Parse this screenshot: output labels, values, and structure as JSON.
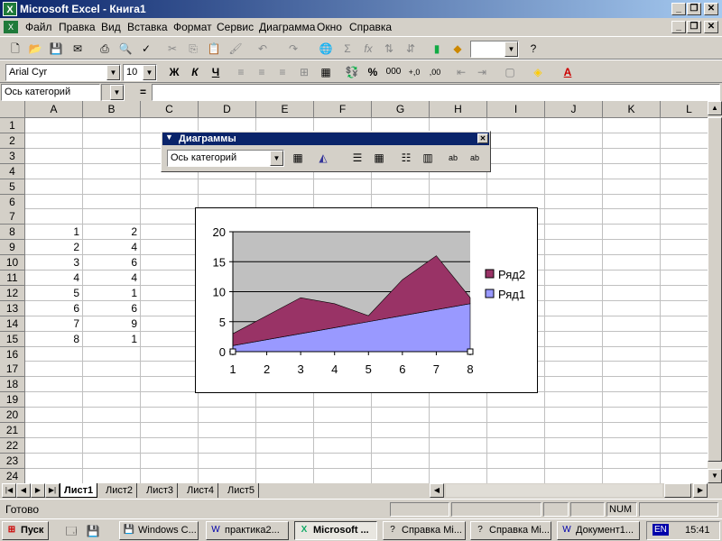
{
  "window": {
    "title": "Microsoft Excel - Книга1",
    "app_icon": "excel-icon"
  },
  "menu": [
    "Файл",
    "Правка",
    "Вид",
    "Вставка",
    "Формат",
    "Сервис",
    "Диаграмма",
    "Окно",
    "Справка"
  ],
  "formatting": {
    "font": "Arial Cyr",
    "size": "10",
    "bold": "Ж",
    "italic": "К",
    "underline": "Ч",
    "percent": "%",
    "thousands": "000",
    "inc_decimal": "+,0",
    "dec_decimal": ",00"
  },
  "formula_bar": {
    "name_box": "Ось категорий",
    "equals": "=",
    "value": ""
  },
  "columns": [
    "A",
    "B",
    "C",
    "D",
    "E",
    "F",
    "G",
    "H",
    "I",
    "J",
    "K",
    "L"
  ],
  "rows": [
    "1",
    "2",
    "3",
    "4",
    "5",
    "6",
    "7",
    "8",
    "9",
    "10",
    "11",
    "12",
    "13",
    "14",
    "15",
    "16",
    "17",
    "18",
    "19",
    "20",
    "21",
    "22",
    "23",
    "24"
  ],
  "cells": {
    "A": [
      "1",
      "2",
      "3",
      "4",
      "5",
      "6",
      "7",
      "8"
    ],
    "B": [
      "2",
      "4",
      "6",
      "4",
      "1",
      "6",
      "9",
      "1"
    ]
  },
  "chart_toolbar": {
    "title": "Диаграммы",
    "selector": "Ось категорий"
  },
  "chart_data": {
    "type": "area",
    "stacked": true,
    "categories": [
      "1",
      "2",
      "3",
      "4",
      "5",
      "6",
      "7",
      "8"
    ],
    "series": [
      {
        "name": "Ряд1",
        "values": [
          1,
          2,
          3,
          4,
          5,
          6,
          7,
          8
        ],
        "color": "#9999ff"
      },
      {
        "name": "Ряд2",
        "values": [
          2,
          4,
          6,
          4,
          1,
          6,
          9,
          1
        ],
        "color": "#993366"
      }
    ],
    "ylim": [
      0,
      20
    ],
    "yticks": [
      "0",
      "5",
      "10",
      "15",
      "20"
    ],
    "plot_background": "#c0c0c0",
    "grid": true,
    "legend": "right"
  },
  "sheets": {
    "tabs": [
      "Лист1",
      "Лист2",
      "Лист3",
      "Лист4",
      "Лист5"
    ],
    "active": "Лист1"
  },
  "status": {
    "text": "Готово",
    "num": "NUM"
  },
  "taskbar": {
    "start": "Пуск",
    "buttons": [
      "Windows C...",
      "практика2...",
      "Microsoft ...",
      "Справка Mi...",
      "Справка Mi...",
      "Документ1..."
    ],
    "lang": "EN",
    "clock": "15:41"
  }
}
